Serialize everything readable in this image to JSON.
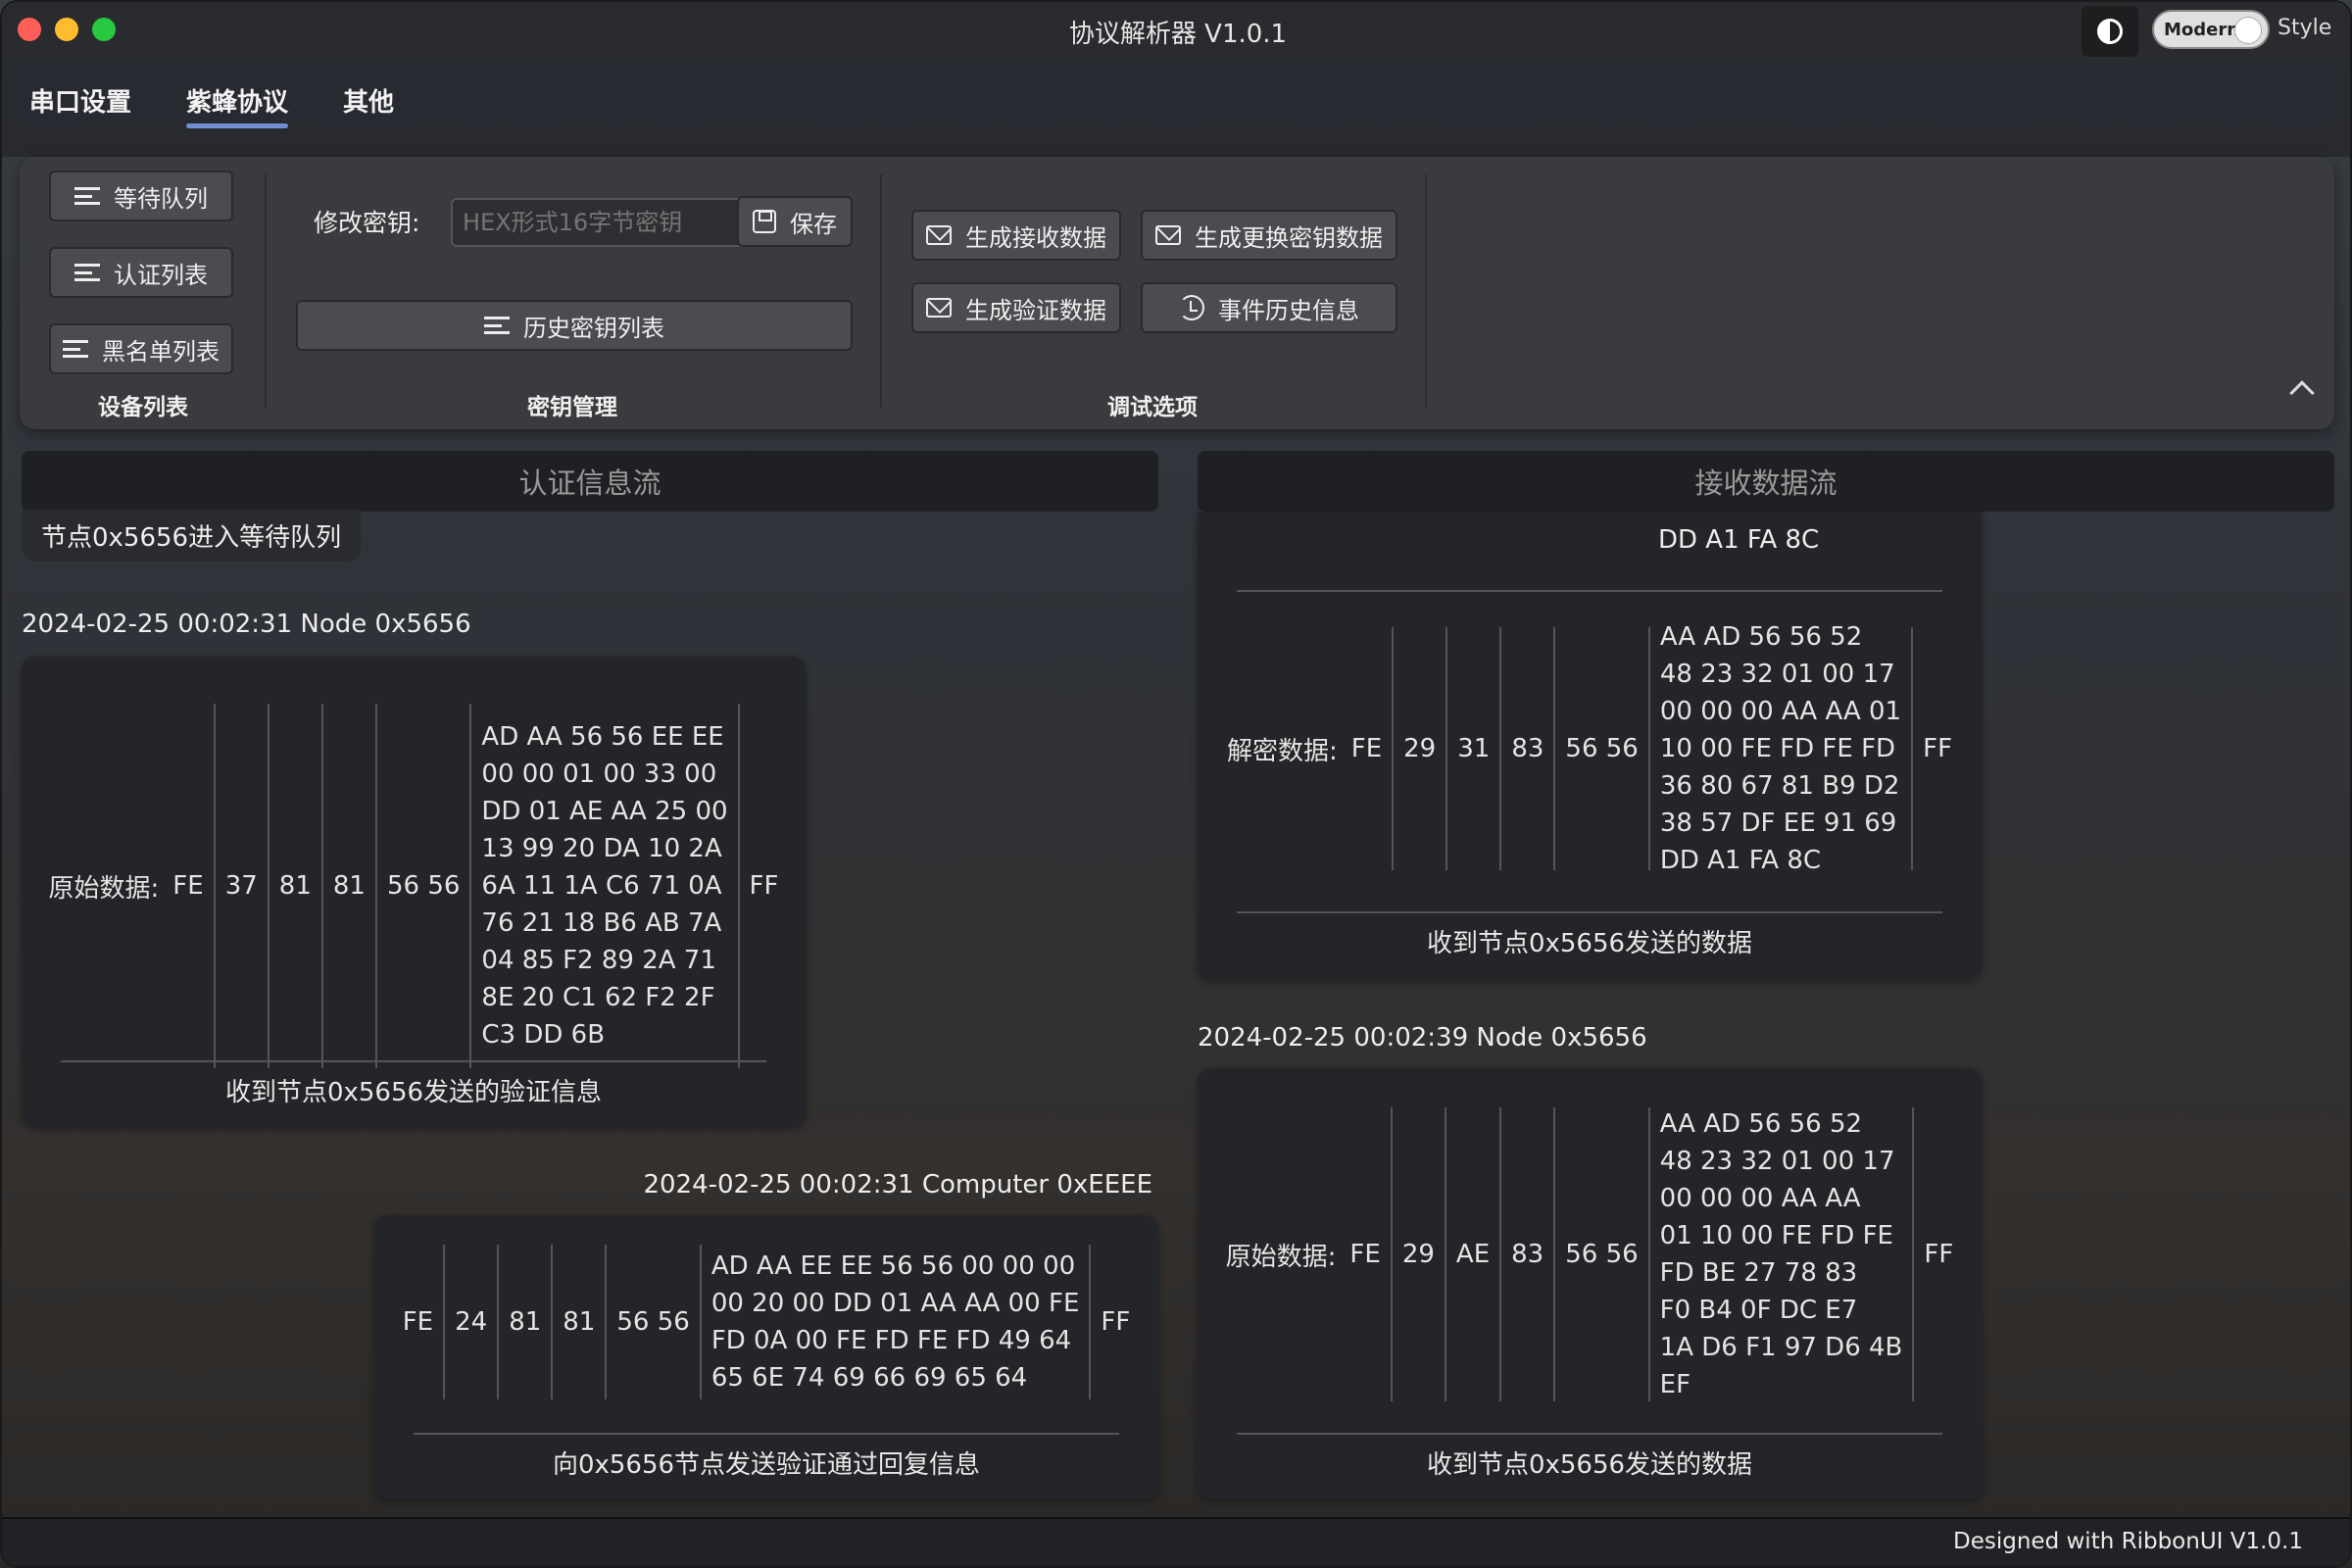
{
  "window": {
    "title": "协议解析器 V1.0.1",
    "style_toggle": "Modern",
    "style_label": "Style"
  },
  "tabs": [
    "串口设置",
    "紫蜂协议",
    "其他"
  ],
  "ribbon": {
    "device_buttons": [
      "等待队列",
      "认证列表",
      "黑名单列表"
    ],
    "device_group": "设备列表",
    "key_label": "修改密钥:",
    "key_placeholder": "HEX形式16字节密钥",
    "save_label": "保存",
    "history_keys_label": "历史密钥列表",
    "key_group": "密钥管理",
    "debug_buttons": [
      "生成接收数据",
      "生成更换密钥数据",
      "生成验证数据",
      "事件历史信息"
    ],
    "debug_group": "调试选项"
  },
  "left": {
    "header": "认证信息流",
    "note": "节点0x5656进入等待队列",
    "msg1": {
      "ts": "2024-02-25 00:02:31  Node 0x5656",
      "label": "原始数据:",
      "cells": [
        "FE",
        "37",
        "81",
        "81",
        "56 56"
      ],
      "data": [
        "AD AA 56 56 EE EE",
        "00 00 01 00 33 00",
        "DD 01 AE AA 25 00",
        "13 99 20 DA 10 2A",
        "6A 11 1A C6 71 0A",
        "76 21 18 B6 AB 7A",
        "04 85 F2 89 2A 71",
        "8E 20 C1 62 F2 2F",
        "C3 DD 6B"
      ],
      "end": "FF",
      "caption": "收到节点0x5656发送的验证信息"
    },
    "msg2": {
      "ts": "2024-02-25 00:02:31  Computer 0xEEEE",
      "cells": [
        "FE",
        "24",
        "81",
        "81",
        "56 56"
      ],
      "data": [
        "AD AA EE EE 56 56 00 00 00",
        "00 20 00 DD 01 AA AA 00 FE",
        "FD 0A 00 FE FD FE FD 49 64",
        "65 6E 74 69 66 69 65 64"
      ],
      "end": "FF",
      "caption": "向0x5656节点发送验证通过回复信息"
    }
  },
  "right": {
    "header": "接收数据流",
    "msg0_tail": "DD A1 FA 8C",
    "msg1": {
      "label": "解密数据:",
      "cells": [
        "FE",
        "29",
        "31",
        "83",
        "56 56"
      ],
      "data": [
        "AA AD 56 56 52",
        "48 23 32 01 00 17",
        "00 00 00 AA AA 01",
        "10 00 FE FD FE FD",
        "36 80 67 81 B9 D2",
        "38 57 DF EE 91 69",
        "DD A1 FA 8C"
      ],
      "end": "FF",
      "caption": "收到节点0x5656发送的数据"
    },
    "msg2": {
      "ts": "2024-02-25 00:02:39  Node 0x5656",
      "label": "原始数据:",
      "cells": [
        "FE",
        "29",
        "AE",
        "83",
        "56 56"
      ],
      "data": [
        "AA AD 56 56 52",
        "48 23 32 01 00 17",
        "00 00 00 AA AA",
        "01 10 00 FE FD FE",
        "FD BE 27 78 83",
        "F0 B4 0F DC E7",
        "1A D6 F1 97 D6 4B",
        "EF"
      ],
      "end": "FF",
      "caption": "收到节点0x5656发送的数据"
    }
  },
  "footer": "Designed with RibbonUI V1.0.1"
}
